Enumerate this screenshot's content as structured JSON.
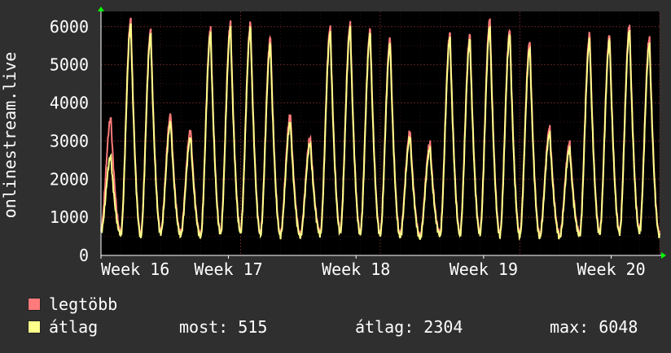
{
  "chart_data": {
    "type": "line",
    "ylabel": "onlinestream.live",
    "yticks": [
      0,
      1000,
      2000,
      3000,
      4000,
      5000,
      6000
    ],
    "ylim": [
      0,
      6400
    ],
    "xticks": [
      "Week 16",
      "Week 17",
      "Week 18",
      "Week 19",
      "Week 20"
    ],
    "grid": true,
    "colors": {
      "background": "#000000",
      "outer": "#2f2f2f",
      "grid": "#5a2222",
      "max_series": "#ff7b7b",
      "avg_series": "#ffff8c",
      "text": "#ffffff",
      "axis_arrow": "#00ff00"
    },
    "series": [
      {
        "name": "legtöbb",
        "color": "#ff7b7b",
        "peaks": [
          3600,
          6200,
          5920,
          3700,
          3300,
          5940,
          6100,
          6080,
          5720,
          3700,
          3100,
          6000,
          6080,
          5920,
          5700,
          3250,
          2950,
          5820,
          5780,
          6200,
          5920,
          5620,
          3350,
          2950,
          5800,
          5780,
          6040,
          5720
        ]
      },
      {
        "name": "átlag",
        "color": "#ffff8c",
        "peaks": [
          2600,
          6050,
          5800,
          3500,
          3100,
          5800,
          5950,
          5950,
          5550,
          3500,
          2950,
          5850,
          5950,
          5800,
          5550,
          3100,
          2800,
          5700,
          5650,
          6000,
          5800,
          5450,
          3200,
          2800,
          5650,
          5650,
          5900,
          5550
        ],
        "troughs": [
          600,
          550,
          500,
          580,
          520,
          480,
          560,
          600,
          540,
          510,
          490,
          550,
          600,
          560,
          520,
          480,
          450,
          520,
          540,
          560,
          520,
          500,
          480,
          470,
          520,
          560,
          580,
          600,
          515
        ]
      }
    ]
  },
  "legend": [
    {
      "label": "legtöbb",
      "color": "#ff7b7b"
    },
    {
      "label": "átlag",
      "color": "#ffff8c"
    }
  ],
  "stats": {
    "now": "most: 515",
    "avg": "átlag: 2304",
    "max": "max: 6048"
  }
}
